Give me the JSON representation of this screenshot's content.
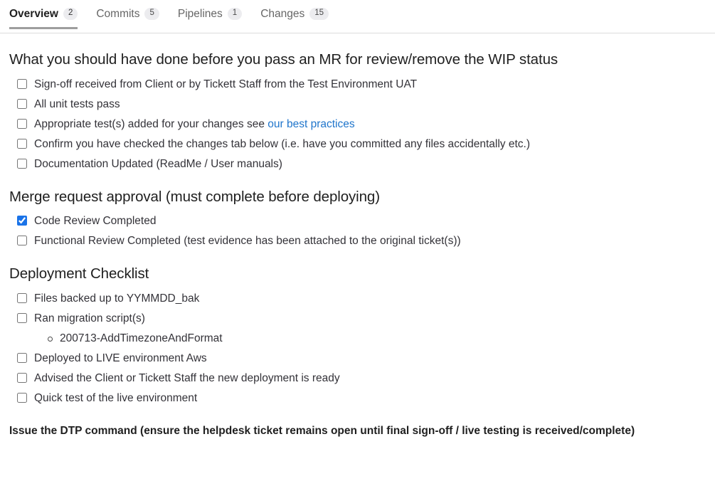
{
  "tabs": [
    {
      "label": "Overview",
      "count": "2",
      "active": true
    },
    {
      "label": "Commits",
      "count": "5",
      "active": false
    },
    {
      "label": "Pipelines",
      "count": "1",
      "active": false
    },
    {
      "label": "Changes",
      "count": "15",
      "active": false
    }
  ],
  "sections": {
    "pre_review": {
      "heading": "What you should have done before you pass an MR for review/remove the WIP status",
      "items": [
        {
          "label": "Sign-off received from Client or by Tickett Staff from the Test Environment UAT",
          "checked": false
        },
        {
          "label": "All unit tests pass",
          "checked": false
        },
        {
          "label_before": "Appropriate test(s) added for your changes see ",
          "link": "our best practices",
          "label_after": "",
          "checked": false
        },
        {
          "label": "Confirm you have checked the changes tab below (i.e. have you committed any files accidentally etc.)",
          "checked": false
        },
        {
          "label": "Documentation Updated (ReadMe / User manuals)",
          "checked": false
        }
      ]
    },
    "approval": {
      "heading": "Merge request approval (must complete before deploying)",
      "items": [
        {
          "label": "Code Review Completed",
          "checked": true
        },
        {
          "label": "Functional Review Completed (test evidence has been attached to the original ticket(s))",
          "checked": false
        }
      ]
    },
    "deployment": {
      "heading": "Deployment Checklist",
      "items": [
        {
          "label": "Files backed up to YYMMDD_bak",
          "checked": false
        },
        {
          "label": "Ran migration script(s)",
          "checked": false,
          "sub_items": [
            "200713-AddTimezoneAndFormat"
          ]
        },
        {
          "label": "Deployed to LIVE environment Aws",
          "checked": false
        },
        {
          "label": "Advised the Client or Tickett Staff the new deployment is ready",
          "checked": false
        },
        {
          "label": "Quick test of the live environment",
          "checked": false
        }
      ]
    },
    "footer_note": "Issue the DTP command (ensure the helpdesk ticket remains open until final sign-off / live testing is received/complete)"
  },
  "colors": {
    "link": "#1f75cb",
    "checkbox_checked": "#1a73e8",
    "active_tab_underline": "#9e9e9e",
    "badge_bg": "#ececef",
    "text": "#333238"
  }
}
